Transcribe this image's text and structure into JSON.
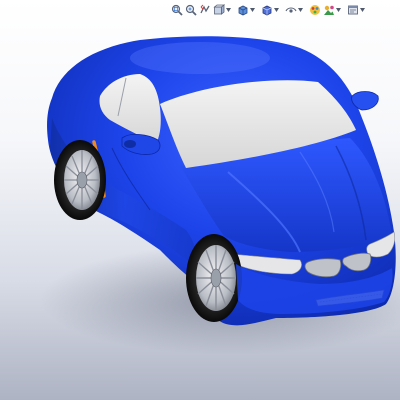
{
  "viewport": {
    "background_top": "#ffffff",
    "background_bottom": "#aeb3c4"
  },
  "heads_up_toolbar": {
    "buttons": [
      {
        "name": "zoom-to-fit",
        "icon": "zoom-fit-icon"
      },
      {
        "name": "zoom-to-area",
        "icon": "zoom-area-icon"
      },
      {
        "name": "previous-view",
        "icon": "previous-view-icon"
      },
      {
        "name": "section-view",
        "icon": "section-view-icon",
        "dropdown": true
      },
      {
        "name": "view-orientation",
        "icon": "view-orientation-cube-icon",
        "dropdown": true
      },
      {
        "name": "display-style",
        "icon": "display-style-icon",
        "dropdown": true
      },
      {
        "name": "hide-show-items",
        "icon": "hide-show-items-icon",
        "dropdown": true
      },
      {
        "name": "edit-appearance",
        "icon": "edit-appearance-icon",
        "dropdown": true
      },
      {
        "name": "apply-scene",
        "icon": "apply-scene-icon",
        "dropdown": true
      },
      {
        "name": "view-settings",
        "icon": "view-settings-icon",
        "dropdown": true
      }
    ]
  },
  "model": {
    "name": "car-model",
    "body_color": "#1a3fe0",
    "glass_color": "#e4e4e4",
    "accent_color": "#f08a1e"
  }
}
